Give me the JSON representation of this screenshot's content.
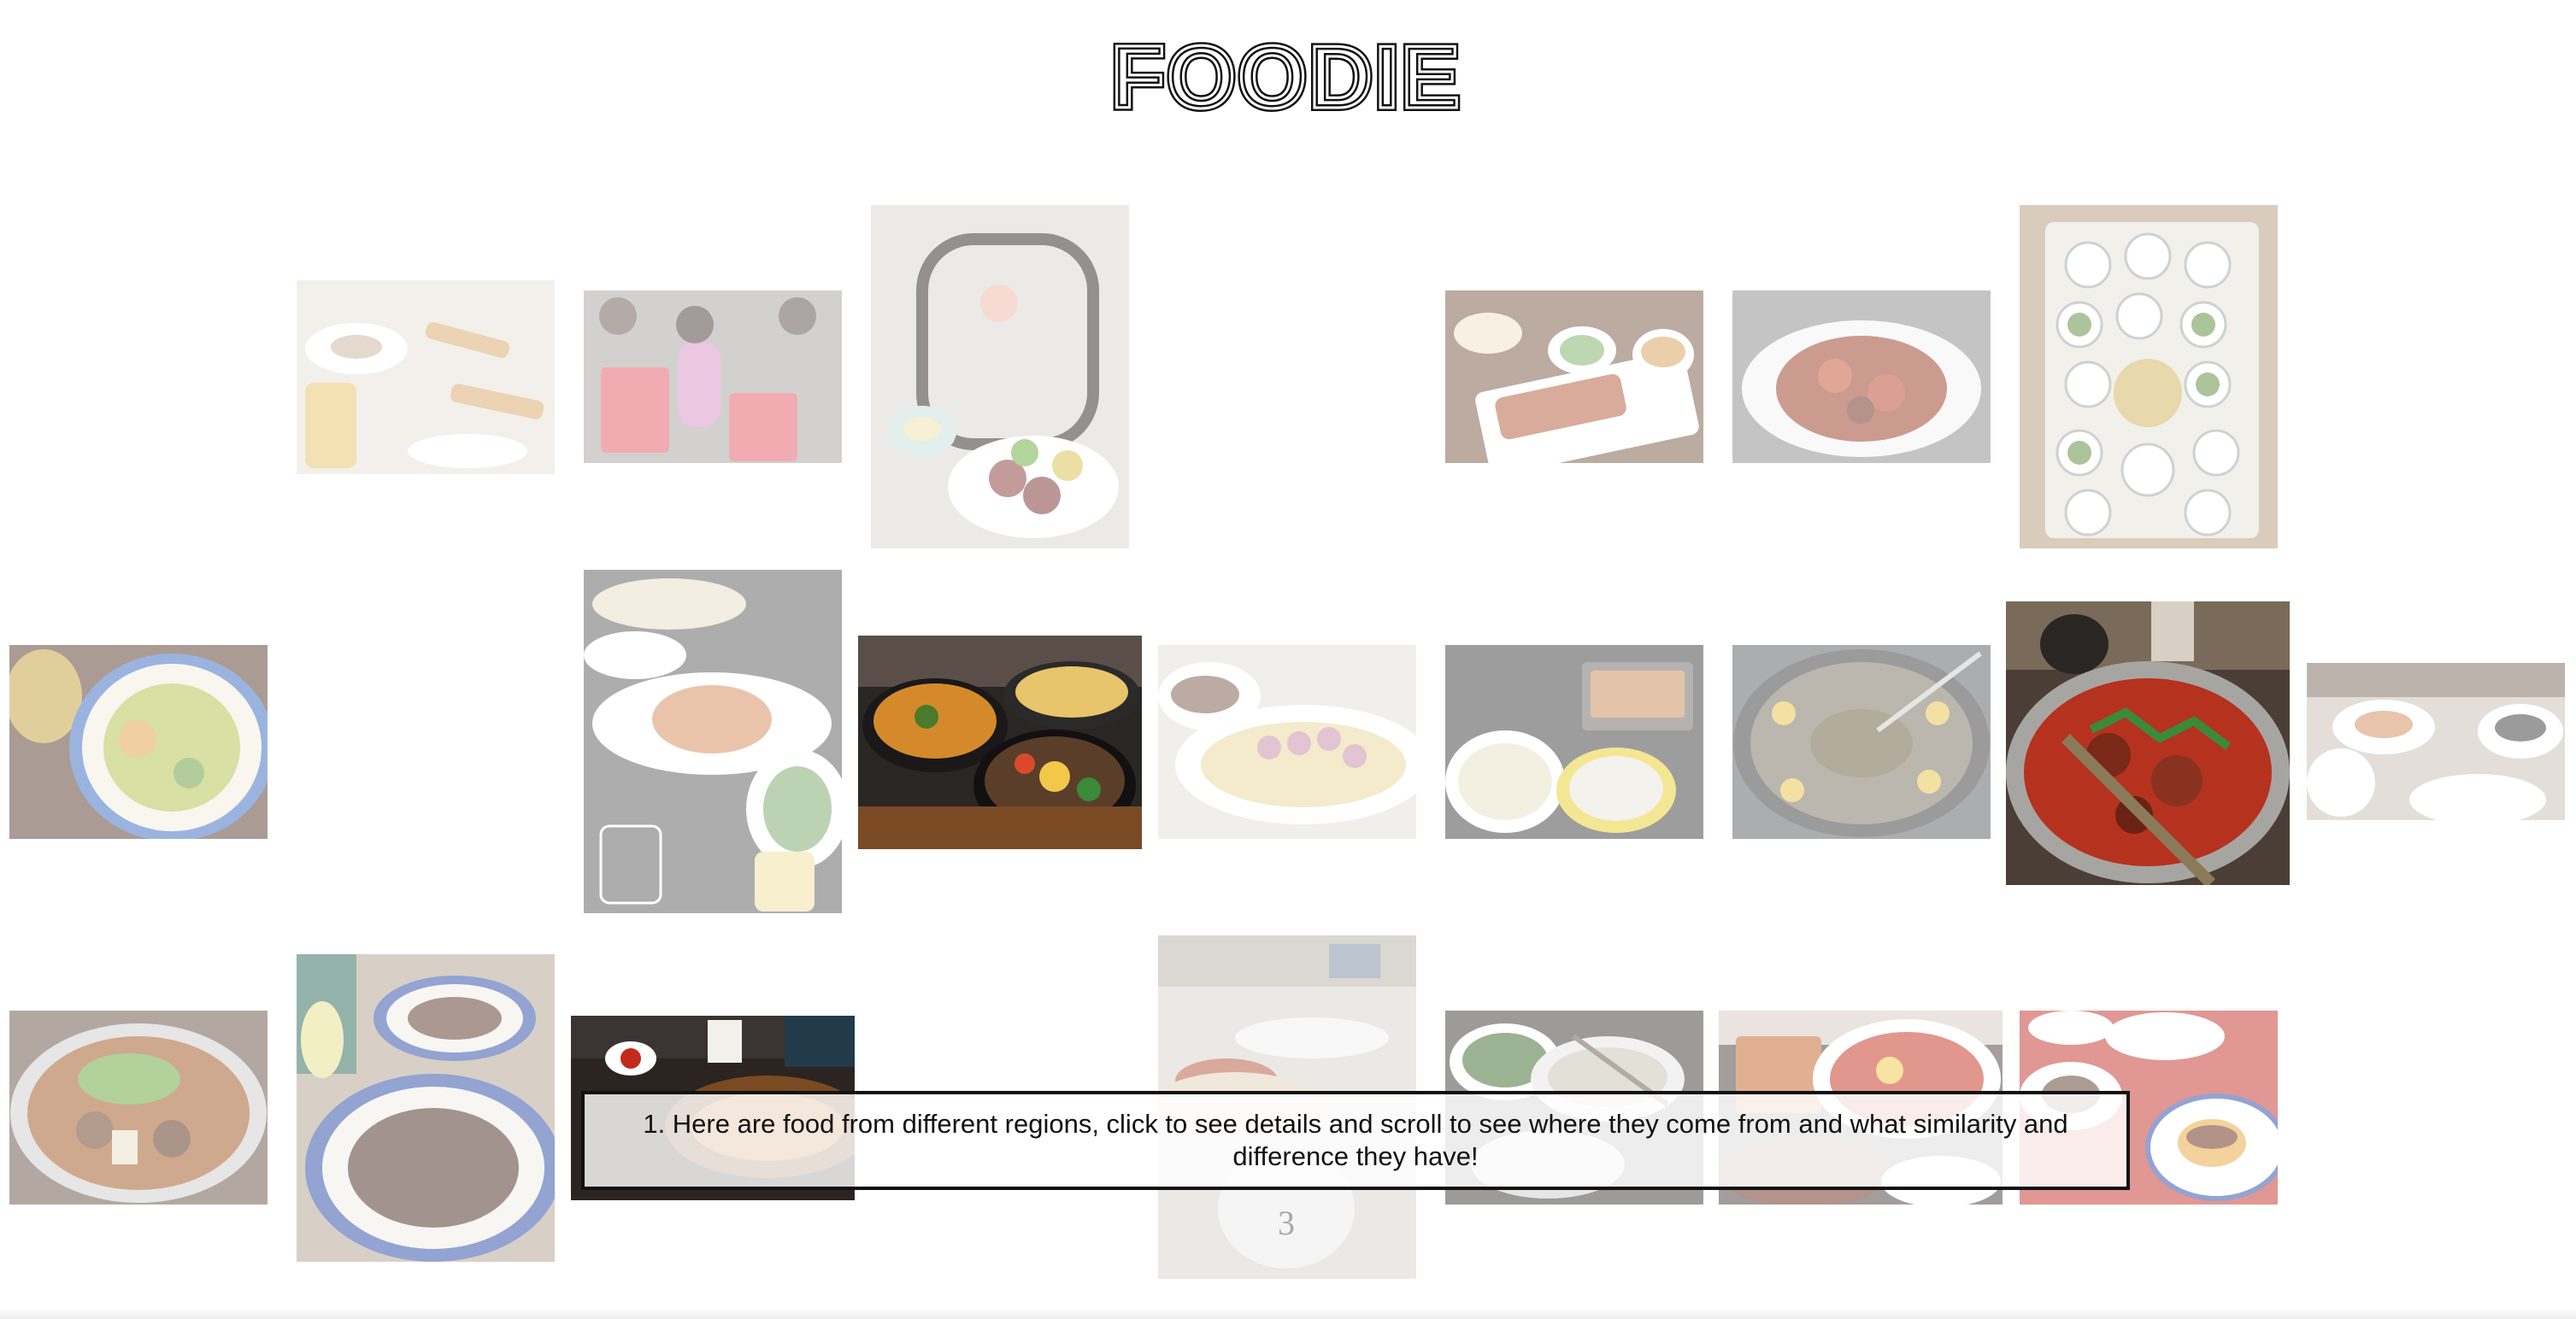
{
  "logo": {
    "text": "FOODIE"
  },
  "caption": {
    "text": "1. Here are food from different regions, click to see details and scroll to see where they come from and what similarity and difference they have!"
  },
  "colors": {
    "outline": "#111111",
    "background": "#ffffff"
  }
}
